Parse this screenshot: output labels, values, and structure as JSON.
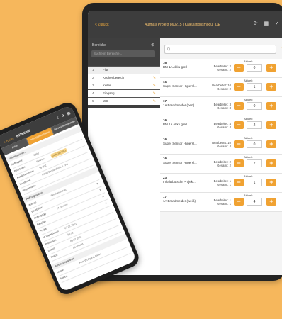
{
  "tablet": {
    "back_label": "< Zurück",
    "title": "Aufmaß Projekt 860215 | Kalkulationsmodul_DE",
    "icons": [
      "refresh-icon",
      "calculator-icon",
      "check-icon"
    ],
    "sidebar": {
      "title": "Bereiche",
      "search_placeholder": "Suche in Bereiche...",
      "rows": [
        {
          "num": "1",
          "label": "Flur"
        },
        {
          "num": "2",
          "label": "Küchenbereich"
        },
        {
          "num": "3",
          "label": "Keller"
        },
        {
          "num": "4",
          "label": "Eingang"
        },
        {
          "num": "5",
          "label": "WC"
        }
      ]
    },
    "main": {
      "search_placeholder": "Q",
      "add_icon": "+",
      "aktuell_label": "Aktuell:",
      "items": [
        {
          "id": "16",
          "name": "BM 1A Akku grell",
          "req1": "Bearbeitet: 2",
          "req2": "Gesamt: 2",
          "value": "0"
        },
        {
          "id": "16",
          "name": "Super Sensor Hypersl...",
          "req1": "Bearbeitet: 10",
          "req2": "Gesamt: 2",
          "value": "1"
        },
        {
          "id": "17",
          "name": "1A Brandmelder (bert)",
          "req1": "Bearbeitet: 3",
          "req2": "Gesamt: 3",
          "value": "0"
        },
        {
          "id": "16",
          "name": "BM 1A Akku grell",
          "req1": "Bearbeitet: 4",
          "req2": "Gesamt: 4",
          "value": "2"
        },
        {
          "id": "16",
          "name": "Super Sensor Hypersl...",
          "req1": "Bearbeitet: 10",
          "req2": "Gesamt: 4",
          "value": "0"
        },
        {
          "id": "16",
          "name": "Super Sensor Hypersl...",
          "req1": "Bearbeitet: 2",
          "req2": "Gesamt: 2",
          "value": "2"
        },
        {
          "id": "23",
          "name": "Inhaltsbotschr Projekt...",
          "req1": "Bearbeitet: 1",
          "req2": "Gesamt: 1",
          "value": "1"
        },
        {
          "id": "17",
          "name": "1A Brandmelder (weiß)",
          "req1": "Bearbeitet: 1",
          "req2": "Gesamt: 1",
          "value": "4"
        }
      ]
    }
  },
  "phone": {
    "back_label": "< Zurück",
    "title": "8509/6046",
    "icons": [
      "upload-icon",
      "refresh-icon",
      "calculator-icon"
    ],
    "tabs": [
      "Aktion",
      "Auftragsinformation",
      "Adressinformationen"
    ],
    "sections": [
      {
        "title": "Informationen",
        "fields": [
          {
            "label": "Auftragsnr.",
            "value": "0800"
          },
          {
            "label": "Bearbeiter",
            "value": "Service"
          },
          {
            "label": "Kundennummer",
            "value": "16 002"
          },
          {
            "label": "Kundennr.",
            "value": "Inhalt/Bestandteile 1, 3-6"
          },
          {
            "label": "Projektname",
            "value": ""
          }
        ]
      },
      {
        "title": "Auftragsdaten",
        "fields": [
          {
            "label": "Auftrag",
            "value": "Servicevertrag"
          },
          {
            "label": "Bearbeiter",
            "value": ""
          },
          {
            "label": "Auftragstyp",
            "value": "1A Service"
          },
          {
            "label": "Bauplan",
            "value": ""
          },
          {
            "label": "Projekt",
            "value": ""
          },
          {
            "label": "Ab Lagerdatum",
            "value": "07.01.2021"
          },
          {
            "label": "Prüfdatum",
            "value": "09.02"
          },
          {
            "label": "Datum",
            "value": "09.02.2021"
          },
          {
            "label": "Status",
            "value": "Ist erfasst"
          }
        ]
      },
      {
        "title": "Ansprechpartner",
        "fields": [
          {
            "label": "Name",
            "value": "Herr Wolfgang Meier"
          },
          {
            "label": "Telefon",
            "value": ""
          }
        ]
      }
    ],
    "badge": "Gültig bis 2022"
  }
}
